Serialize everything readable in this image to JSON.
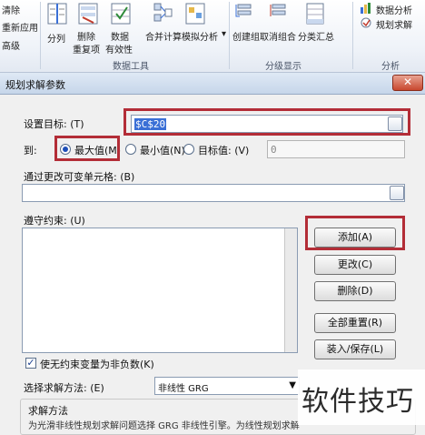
{
  "ribbon": {
    "left_items": [
      "清除",
      "重新应用",
      "高级"
    ],
    "data_tools": {
      "split": "分列",
      "remove_dup": "删除",
      "remove_dup2": "重复项",
      "validation": "数据",
      "validation2": "有效性",
      "consolidate": "合并计算",
      "whatif": "模拟分析",
      "group_label": "数据工具"
    },
    "outline": {
      "group": "创建组",
      "ungroup": "取消组合",
      "subtotal": "分类汇总",
      "group_label": "分级显示"
    },
    "analysis": {
      "data_analysis": "数据分析",
      "solver": "规划求解",
      "group_label": "分析"
    }
  },
  "dialog": {
    "title": "规划求解参数",
    "close_glyph": "✕",
    "objective_label": "设置目标: (T)",
    "objective_value": "$C$20",
    "to_label": "到:",
    "opt_max": "最大值(M)",
    "opt_min": "最小值(N)",
    "opt_value": "目标值: (V)",
    "target_value": "0",
    "variable_label": "通过更改可变单元格: (B)",
    "variable_value": "",
    "constraints_label": "遵守约束: (U)",
    "buttons": {
      "add": "添加(A)",
      "change": "更改(C)",
      "delete": "删除(D)",
      "reset": "全部重置(R)",
      "load_save": "装入/保存(L)"
    },
    "nonneg_label": "使无约束变量为非负数(K)",
    "nonneg_checked": true,
    "method_label": "选择求解方法: (E)",
    "method_value": "非线性 GRG",
    "method_group": "求解方法",
    "method_desc": "为光滑非线性规划求解问题选择 GRG 非线性引擎。为线性规划求解"
  },
  "watermark": "软件技巧",
  "colors": {
    "highlight": "#b32d37",
    "selection": "#3a6fd6"
  }
}
